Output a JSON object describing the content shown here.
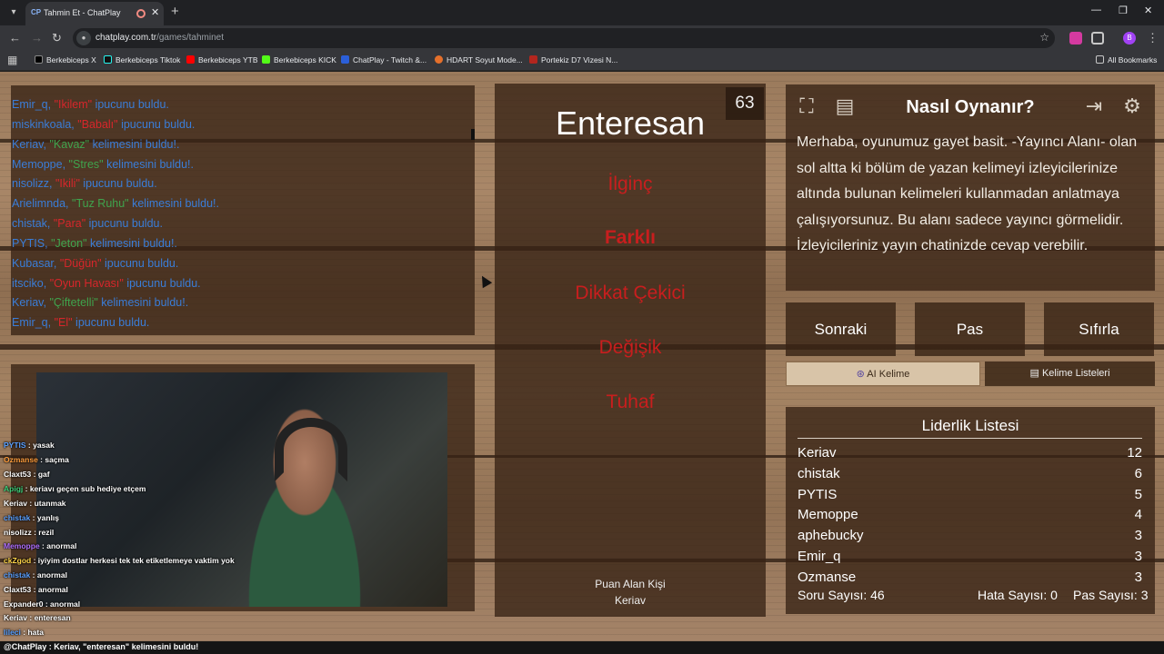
{
  "browser": {
    "tab_title": "Tahmin Et - ChatPlay",
    "tab_favicon": "CP",
    "url_host": "chatplay.com.tr",
    "url_path": "/games/tahminet",
    "profile_initial": "B",
    "bookmarks": [
      "Berkebiceps X",
      "Berkebiceps Tiktok",
      "Berkebiceps YTB",
      "Berkebiceps KICK",
      "ChatPlay - Twitch &...",
      "HDART Soyut Mode...",
      "Portekiz D7 Vizesi N..."
    ],
    "all_bookmarks": "All Bookmarks"
  },
  "log": [
    {
      "user": "Emir_q,",
      "word": "\"Ikilem\"",
      "word_color": "red",
      "suffix": "ipucunu buldu."
    },
    {
      "user": "miskinkoala,",
      "word": "\"Babalı\"",
      "word_color": "red",
      "suffix": "ipucunu buldu."
    },
    {
      "user": "Keriav,",
      "word": "\"Kavaz\"",
      "word_color": "green",
      "suffix": "kelimesini buldu!."
    },
    {
      "user": "Memoppe,",
      "word": "\"Stres\"",
      "word_color": "green",
      "suffix": "kelimesini buldu!."
    },
    {
      "user": "nisolizz,",
      "word": "\"Ikili\"",
      "word_color": "red",
      "suffix": "ipucunu buldu."
    },
    {
      "user": "Arielimnda,",
      "word": "\"Tuz Ruhu\"",
      "word_color": "green",
      "suffix": "kelimesini buldu!."
    },
    {
      "user": "chistak,",
      "word": "\"Para\"",
      "word_color": "red",
      "suffix": "ipucunu buldu."
    },
    {
      "user": "PYTIS,",
      "word": "\"Jeton\"",
      "word_color": "green",
      "suffix": "kelimesini buldu!."
    },
    {
      "user": "Kubasar,",
      "word": "\"Düğün\"",
      "word_color": "red",
      "suffix": "ipucunu buldu."
    },
    {
      "user": "itsciko,",
      "word": "\"Oyun Havası\"",
      "word_color": "red",
      "suffix": "ipucunu buldu."
    },
    {
      "user": "Keriav,",
      "word": "\"Çiftetelli\"",
      "word_color": "green",
      "suffix": "kelimesini buldu!."
    },
    {
      "user": "Emir_q,",
      "word": "\"El\"",
      "word_color": "red",
      "suffix": "ipucunu buldu."
    }
  ],
  "stream_chat": [
    {
      "user": "PYTIS",
      "msg": "yasak",
      "color": "#5aa0ff"
    },
    {
      "user": "Ozmanse",
      "msg": "saçma",
      "color": "#ff9d3c"
    },
    {
      "user": "Claxt53",
      "msg": "gaf",
      "color": "#ffffff"
    },
    {
      "user": "Apigj",
      "msg": "keriavı geçen sub hediye etçem",
      "color": "#3fd17a"
    },
    {
      "user": "Keriav",
      "msg": "utanmak",
      "color": "#ffffff"
    },
    {
      "user": "chistak",
      "msg": "yanlış",
      "color": "#5aa0ff"
    },
    {
      "user": "nisolizz",
      "msg": "rezil",
      "color": "#ffffff"
    },
    {
      "user": "Memoppe",
      "msg": "anormal",
      "color": "#b070ff"
    },
    {
      "user": "ckZgod",
      "msg": "iyiyim dostlar herkesi tek tek etiketlemeye vaktim yok",
      "color": "#ffd54a"
    },
    {
      "user": "chistak",
      "msg": "anormal",
      "color": "#5aa0ff"
    },
    {
      "user": "Claxt53",
      "msg": "anormal",
      "color": "#ffffff"
    },
    {
      "user": "Expander0",
      "msg": "anormal",
      "color": "#ffffff"
    },
    {
      "user": "Keriav",
      "msg": "enteresan",
      "color": "#ffffff"
    },
    {
      "user": "lileci",
      "msg": "hata",
      "color": "#5aa0ff"
    }
  ],
  "bottom_status": "@ChatPlay : Keriav, \"enteresan\" kelimesini buldu!",
  "card": {
    "timer": "63",
    "main_word": "Enteresan",
    "taboo_words": [
      "İlginç",
      "Farklı",
      "Dikkat Çekici",
      "Değişik",
      "Tuhaf"
    ],
    "score_label": "Puan Alan Kişi",
    "score_name": "Keriav"
  },
  "help": {
    "title": "Nasıl Oynanır?",
    "text": "Merhaba, oyunumuz gayet basit. -Yayıncı Alanı- olan sol altta ki bölüm de yazan kelimeyi izleyicilerinize altında bulunan kelimeleri kullanmadan anlatmaya çalışıyorsunuz. Bu alanı sadece yayıncı görmelidir. İzleyicileriniz yayın chatinizde cevap verebilir."
  },
  "buttons": {
    "next": "Sonraki",
    "pass": "Pas",
    "reset": "Sıfırla",
    "ai_word": "AI Kelime",
    "word_lists": "Kelime Listeleri"
  },
  "leaderboard": {
    "title": "Liderlik Listesi",
    "rows": [
      {
        "name": "Keriav",
        "score": "12"
      },
      {
        "name": "chistak",
        "score": "6"
      },
      {
        "name": "PYTIS",
        "score": "5"
      },
      {
        "name": "Memoppe",
        "score": "4"
      },
      {
        "name": "aphebucky",
        "score": "3"
      },
      {
        "name": "Emir_q",
        "score": "3"
      },
      {
        "name": "Ozmanse",
        "score": "3"
      }
    ]
  },
  "stats": {
    "questions": "Soru Sayısı: 46",
    "errors": "Hata Sayısı: 0",
    "passes": "Pas Sayısı: 3"
  },
  "colors": {
    "accent_red": "#c81e1e",
    "log_blue": "#3a7dd8",
    "log_green": "#3fa34d"
  }
}
